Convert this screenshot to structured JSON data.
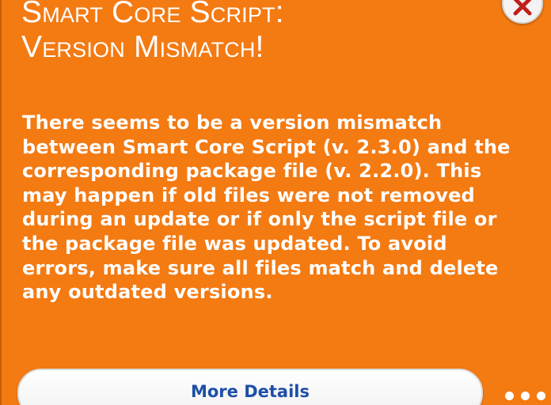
{
  "notification": {
    "title_line1": "Smart Core Script:",
    "title_line2": "Version Mismatch!",
    "message": "There seems to be a version mismatch between Smart Core Script (v. 2.3.0) and the corresponding package file (v. 2.2.0). This may happen if old files were not removed during an update or if only the script file or the package file was updated. To avoid errors, make sure all files match and delete any outdated versions.",
    "details_button_label": "More Details",
    "close_icon": "close-icon",
    "more_icon": "more-options-icon"
  },
  "colors": {
    "background": "#f47a12",
    "text": "#ffffff",
    "button_text": "#1d4fa8",
    "close_x": "#c0201b"
  }
}
